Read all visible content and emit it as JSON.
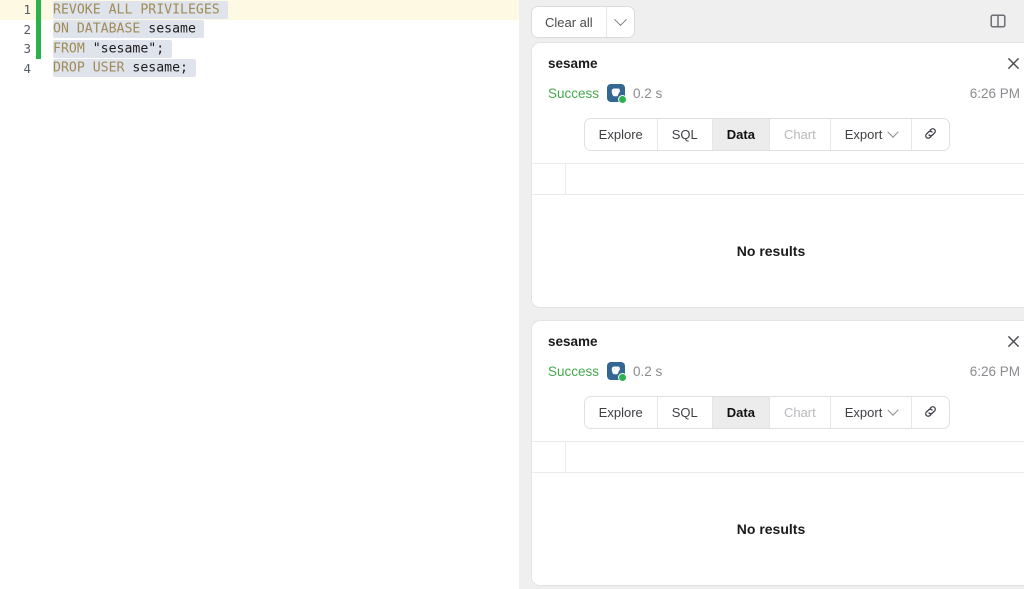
{
  "editor": {
    "lines": [
      {
        "number": "1",
        "active": true,
        "changed": true,
        "tokens": [
          {
            "text": "REVOKE ALL PRIVILEGES",
            "kind": "kw"
          }
        ]
      },
      {
        "number": "2",
        "active": false,
        "changed": true,
        "tokens": [
          {
            "text": "ON DATABASE ",
            "kind": "kw"
          },
          {
            "text": "sesame",
            "kind": "id"
          }
        ]
      },
      {
        "number": "3",
        "active": false,
        "changed": true,
        "tokens": [
          {
            "text": "FROM ",
            "kind": "kw"
          },
          {
            "text": "\"sesame\"",
            "kind": "str"
          },
          {
            "text": ";",
            "kind": "punct"
          }
        ]
      },
      {
        "number": "4",
        "active": false,
        "changed": false,
        "tokens": [
          {
            "text": "DROP USER ",
            "kind": "kw"
          },
          {
            "text": "sesame",
            "kind": "id"
          },
          {
            "text": ";",
            "kind": "punct"
          }
        ]
      }
    ],
    "full_text": "REVOKE ALL PRIVILEGES\nON DATABASE sesame\nFROM \"sesame\";\nDROP USER sesame;"
  },
  "results_panel": {
    "toolbar": {
      "clear_all_label": "Clear all",
      "clear_all_caret_icon": "chevron-down-icon",
      "panel_toggle_icon": "panel-layout-icon"
    },
    "cards": [
      {
        "title": "sesame",
        "close_icon": "close-icon",
        "status": "Success",
        "db_icon": "postgresql-icon",
        "db_status_dot": "connected-dot",
        "duration": "0.2 s",
        "time": "6:26 PM",
        "tabs": [
          {
            "label": "Explore",
            "state": "normal",
            "name": "tab-explore"
          },
          {
            "label": "SQL",
            "state": "normal",
            "name": "tab-sql"
          },
          {
            "label": "Data",
            "state": "active",
            "name": "tab-data"
          },
          {
            "label": "Chart",
            "state": "disabled",
            "name": "tab-chart"
          },
          {
            "label": "Export",
            "state": "normal",
            "name": "tab-export",
            "caret": true
          },
          {
            "label": "",
            "state": "normal",
            "name": "tab-copy-link",
            "icon": "link-icon"
          }
        ],
        "empty_message": "No results"
      },
      {
        "title": "sesame",
        "close_icon": "close-icon",
        "status": "Success",
        "db_icon": "postgresql-icon",
        "db_status_dot": "connected-dot",
        "duration": "0.2 s",
        "time": "6:26 PM",
        "tabs": [
          {
            "label": "Explore",
            "state": "normal",
            "name": "tab-explore"
          },
          {
            "label": "SQL",
            "state": "normal",
            "name": "tab-sql"
          },
          {
            "label": "Data",
            "state": "active",
            "name": "tab-data"
          },
          {
            "label": "Chart",
            "state": "disabled",
            "name": "tab-chart"
          },
          {
            "label": "Export",
            "state": "normal",
            "name": "tab-export",
            "caret": true
          },
          {
            "label": "",
            "state": "normal",
            "name": "tab-copy-link",
            "icon": "link-icon"
          }
        ],
        "empty_message": "No results"
      }
    ]
  },
  "colors": {
    "success_green": "#46a94f",
    "postgres_blue": "#336791",
    "change_marker_green": "#2bb24c",
    "active_line_yellow": "#fdf9e3",
    "selection_blue": "#dfe3ec",
    "keyword_tan": "#a08b55",
    "panel_gray": "#efeff0"
  }
}
